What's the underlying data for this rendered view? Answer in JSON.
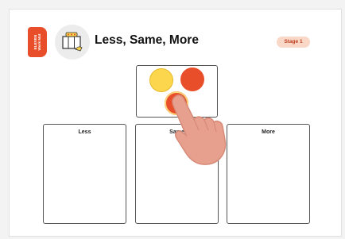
{
  "header": {
    "tab_text_line1": "ELEVEN",
    "tab_text_line2": "Work Mat",
    "title": "Less, Same, More",
    "stage": "Stage 1"
  },
  "mats": [
    {
      "label": "Less"
    },
    {
      "label": "Same"
    },
    {
      "label": "More"
    }
  ],
  "counters": [
    {
      "color": "yellow"
    },
    {
      "color": "red"
    },
    {
      "color": "red"
    }
  ],
  "icons": [
    "work-mat-logo-icon",
    "pointing-hand-icon"
  ],
  "colors": {
    "accent": "#e94e2b",
    "yellow": "#fcd64c",
    "stage_bg": "#f9d8c8"
  }
}
